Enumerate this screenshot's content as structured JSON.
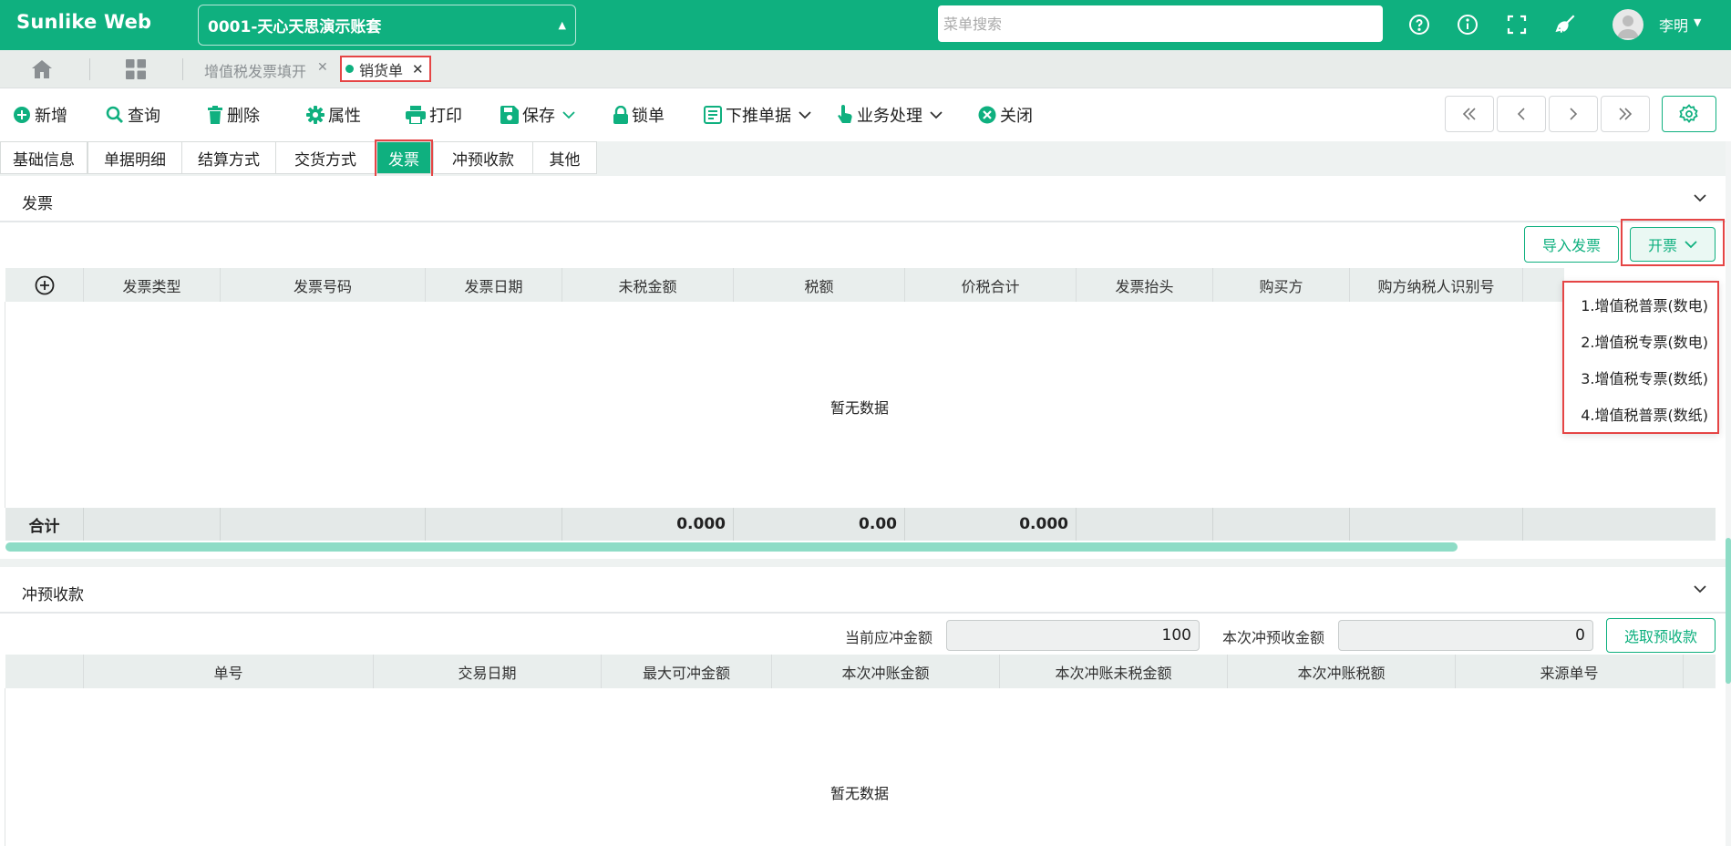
{
  "app": {
    "name": "Sunlike Web"
  },
  "header": {
    "account": "0001-天心天思演示账套",
    "search_placeholder": "菜单搜索",
    "user_name": "李明"
  },
  "tabs": [
    {
      "label": "增值税发票填开",
      "active": false
    },
    {
      "label": "销货单",
      "active": true
    }
  ],
  "toolbar": {
    "new": "新增",
    "query": "查询",
    "delete": "删除",
    "properties": "属性",
    "print": "打印",
    "save": "保存",
    "lock": "锁单",
    "push_down": "下推单据",
    "business": "业务处理",
    "close": "关闭"
  },
  "section_tabs": [
    "基础信息",
    "单据明细",
    "结算方式",
    "交货方式",
    "发票",
    "冲预收款",
    "其他"
  ],
  "invoice_panel": {
    "title": "发票",
    "import_button": "导入发票",
    "issue_button": "开票",
    "columns": [
      "发票类型",
      "发票号码",
      "发票日期",
      "未税金额",
      "税额",
      "价税合计",
      "发票抬头",
      "购买方",
      "购方纳税人识别号"
    ],
    "empty_text": "暂无数据",
    "footer_label": "合计",
    "totals": {
      "untaxed": "0.000",
      "tax": "0.00",
      "total": "0.000"
    },
    "issue_menu": [
      "1.增值税普票(数电)",
      "2.增值税专票(数电)",
      "3.增值税专票(数纸)",
      "4.增值税普票(数纸)"
    ]
  },
  "prepay_panel": {
    "title": "冲预收款",
    "current_label": "当前应冲金额",
    "current_value": "100",
    "this_label": "本次冲预收金额",
    "this_value": "0",
    "select_button": "选取预收款",
    "columns": [
      "单号",
      "交易日期",
      "最大可冲金额",
      "本次冲账金额",
      "本次冲账未税金额",
      "本次冲账税额",
      "来源单号"
    ],
    "empty_text": "暂无数据"
  },
  "colors": {
    "brand": "#0fb07f",
    "highlight": "#e54545"
  }
}
